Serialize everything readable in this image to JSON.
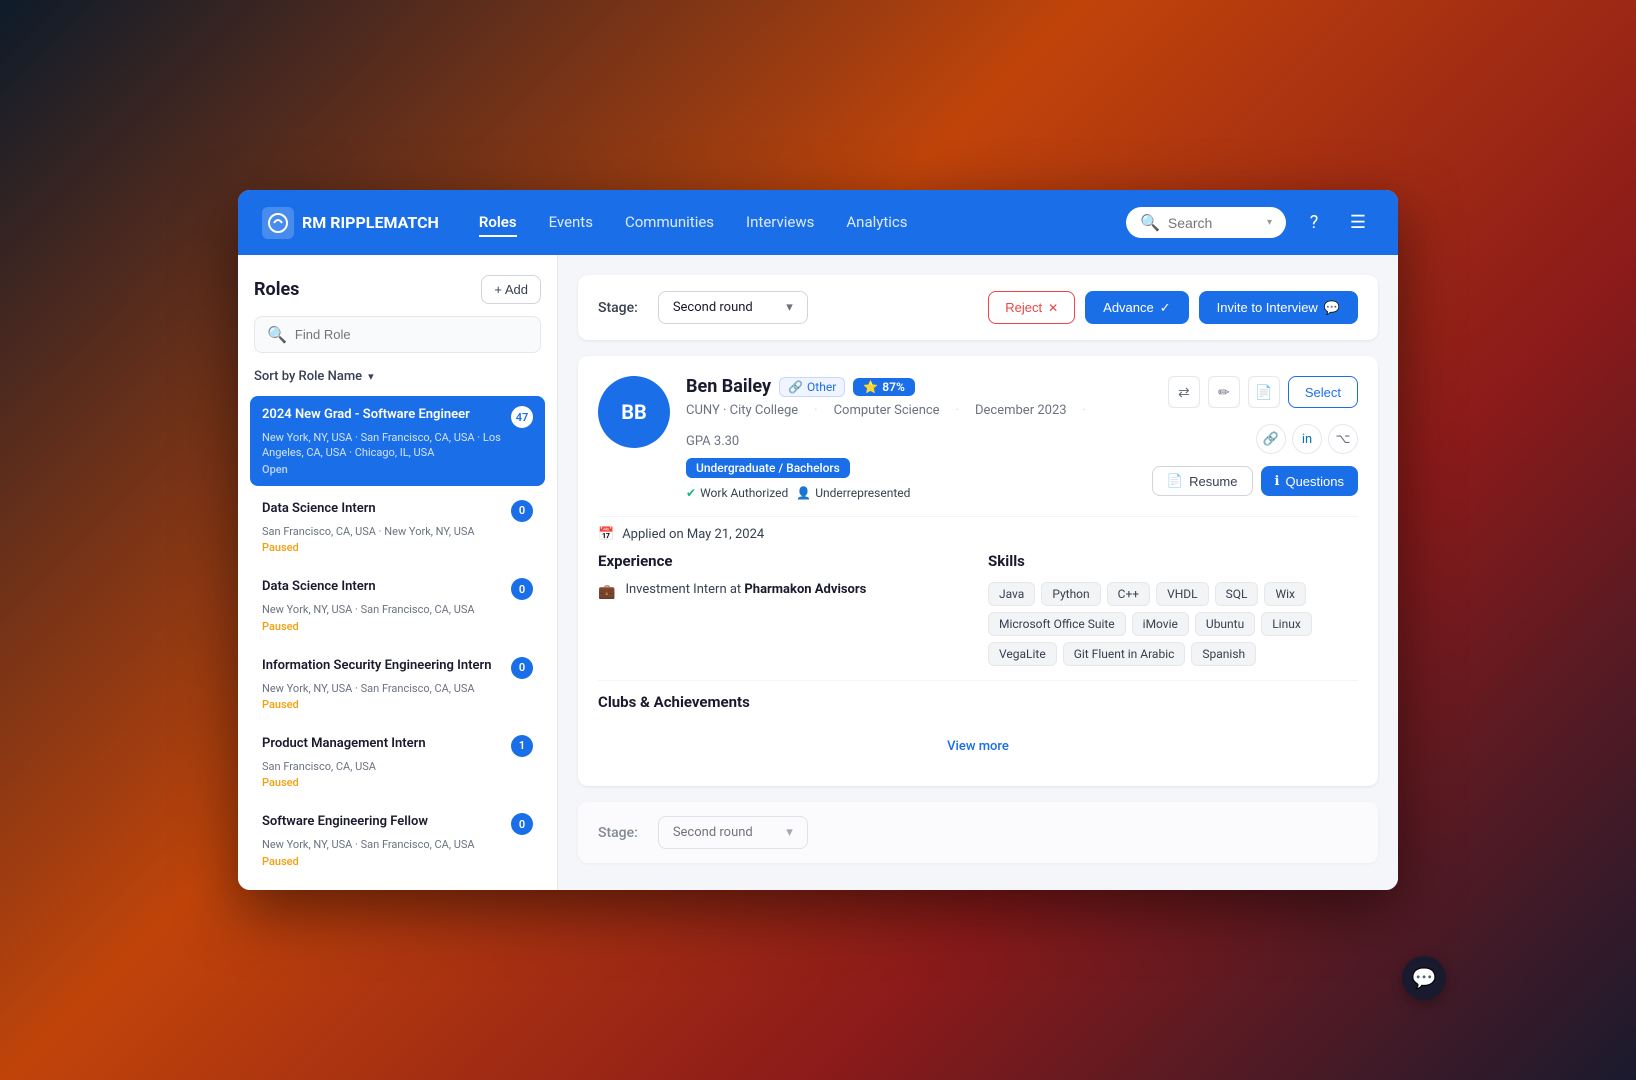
{
  "app": {
    "logo_text": "RM RIPPLEMATCH",
    "logo_abbr": "RM"
  },
  "nav": {
    "items": [
      {
        "label": "Roles",
        "active": true
      },
      {
        "label": "Events",
        "active": false
      },
      {
        "label": "Communities",
        "active": false
      },
      {
        "label": "Interviews",
        "active": false
      },
      {
        "label": "Analytics",
        "active": false
      }
    ]
  },
  "header": {
    "search_placeholder": "Search",
    "search_dropdown_arrow": "▾"
  },
  "sidebar": {
    "title": "Roles",
    "add_label": "+ Add",
    "search_placeholder": "Find Role",
    "sort_label": "Sort by Role Name",
    "roles": [
      {
        "name": "2024 New Grad - Software Engineer",
        "location": "New York, NY, USA · San Francisco, CA, USA · Los Angeles, CA, USA · Chicago, IL, USA",
        "status": "Open",
        "status_type": "open",
        "count": 47,
        "active": true
      },
      {
        "name": "Data Science Intern",
        "location": "San Francisco, CA, USA · New York, NY, USA",
        "status": "Paused",
        "status_type": "paused",
        "count": 0,
        "active": false
      },
      {
        "name": "Data Science Intern",
        "location": "New York, NY, USA · San Francisco, CA, USA",
        "status": "Paused",
        "status_type": "paused",
        "count": 0,
        "active": false
      },
      {
        "name": "Information Security Engineering Intern",
        "location": "New York, NY, USA · San Francisco, CA, USA",
        "status": "Paused",
        "status_type": "paused",
        "count": 0,
        "active": false
      },
      {
        "name": "Product Management Intern",
        "location": "San Francisco, CA, USA",
        "status": "Paused",
        "status_type": "paused",
        "count": 1,
        "active": false
      },
      {
        "name": "Software Engineering Fellow",
        "location": "New York, NY, USA · San Francisco, CA, USA",
        "status": "Paused",
        "status_type": "paused",
        "count": 0,
        "active": false
      }
    ]
  },
  "stage": {
    "label": "Stage:",
    "value": "Second round",
    "reject_label": "Reject",
    "advance_label": "Advance",
    "invite_label": "Invite to Interview"
  },
  "candidate": {
    "initials": "BB",
    "name": "Ben Bailey",
    "tag_other": "Other",
    "match_pct": "87%",
    "school": "CUNY · City College",
    "major": "Computer Science",
    "grad_date": "December 2023",
    "gpa": "GPA 3.30",
    "edu_badge": "Undergraduate / Bachelors",
    "work_authorized": "Work Authorized",
    "underrepresented": "Underrepresented",
    "applied_text": "Applied on May 21, 2024",
    "resume_label": "Resume",
    "questions_label": "Questions",
    "select_label": "Select"
  },
  "experience": {
    "title": "Experience",
    "items": [
      {
        "role": "Investment Intern",
        "company": "Pharmakon Advisors"
      }
    ]
  },
  "skills": {
    "title": "Skills",
    "items": [
      "Java",
      "Python",
      "C++",
      "VHDL",
      "SQL",
      "Wix",
      "Microsoft Office Suite",
      "iMovie",
      "Ubuntu",
      "Linux",
      "VegaLite",
      "Git Fluent in Arabic",
      "Spanish"
    ]
  },
  "clubs": {
    "title": "Clubs & Achievements"
  },
  "view_more": {
    "label": "View more"
  }
}
